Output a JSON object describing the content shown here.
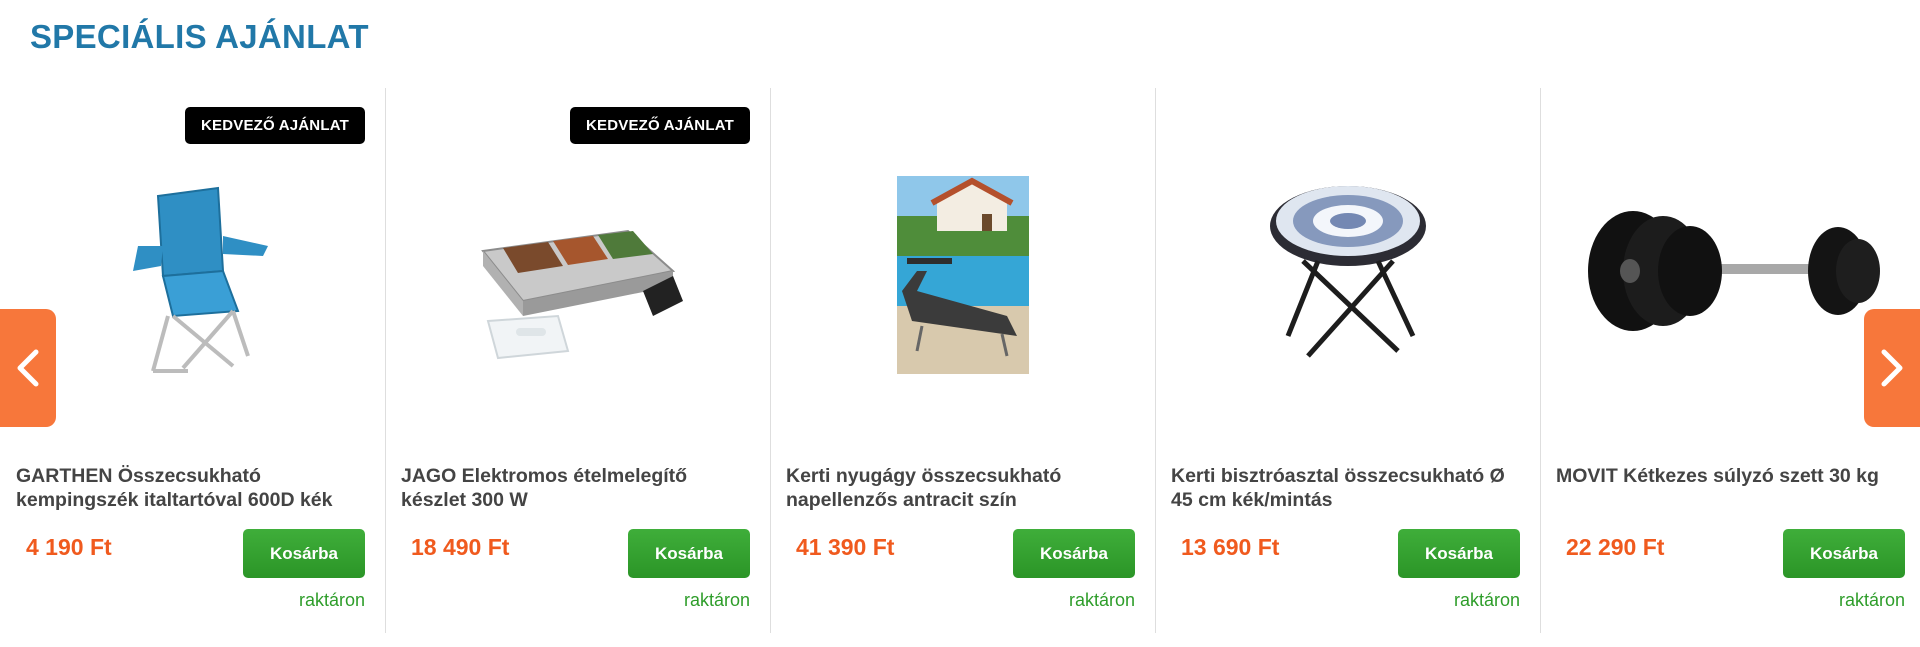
{
  "section": {
    "title": "SPECIÁLIS AJÁNLAT"
  },
  "products": [
    {
      "badge": "KEDVEZŐ AJÁNLAT",
      "name": "GARTHEN Összecsukható kempingszék italtartóval 600D kék",
      "price": "4 190 Ft",
      "cart_label": "Kosárba",
      "stock": "raktáron",
      "icon": "camping-chair-image"
    },
    {
      "badge": "KEDVEZŐ AJÁNLAT",
      "name": "JAGO Elektromos ételmelegítő készlet 300 W",
      "price": "18 490 Ft",
      "cart_label": "Kosárba",
      "stock": "raktáron",
      "icon": "food-warmer-image"
    },
    {
      "badge": "",
      "name": "Kerti nyugágy összecsukható napellenzős antracit szín",
      "price": "41 390 Ft",
      "cart_label": "Kosárba",
      "stock": "raktáron",
      "icon": "sun-lounger-image"
    },
    {
      "badge": "",
      "name": "Kerti bisztróasztal összecsukható Ø 45 cm kék/mintás",
      "price": "13 690 Ft",
      "cart_label": "Kosárba",
      "stock": "raktáron",
      "icon": "bistro-table-image"
    },
    {
      "badge": "",
      "name": "MOVIT Kétkezes súlyzó szett 30 kg",
      "price": "22 290 Ft",
      "cart_label": "Kosárba",
      "stock": "raktáron",
      "icon": "barbell-set-image"
    }
  ],
  "nav": {
    "prev_icon": "chevron-left-icon",
    "next_icon": "chevron-right-icon"
  },
  "colors": {
    "title": "#2178a8",
    "price": "#f05a1e",
    "button": "#2b9527",
    "stock": "#2e9d2a",
    "arrow": "#f7773b",
    "badge": "#000000"
  }
}
